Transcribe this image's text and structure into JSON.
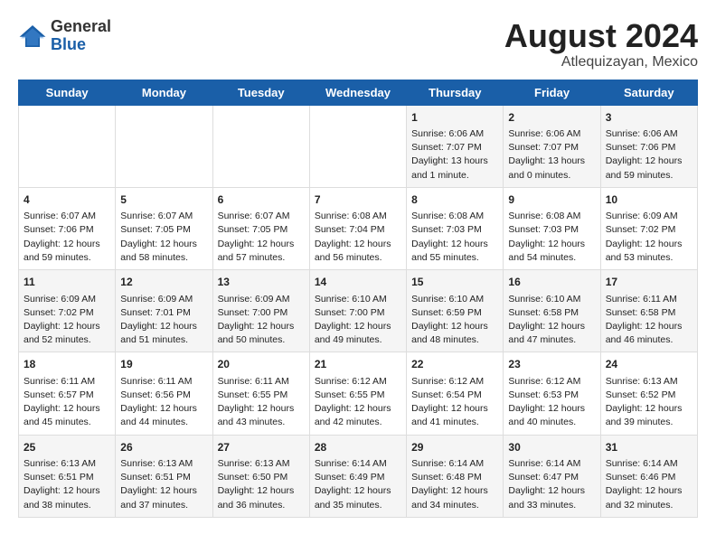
{
  "logo": {
    "general": "General",
    "blue": "Blue"
  },
  "title": {
    "month_year": "August 2024",
    "location": "Atlequizayan, Mexico"
  },
  "days_of_week": [
    "Sunday",
    "Monday",
    "Tuesday",
    "Wednesday",
    "Thursday",
    "Friday",
    "Saturday"
  ],
  "weeks": [
    [
      {
        "day": "",
        "content": ""
      },
      {
        "day": "",
        "content": ""
      },
      {
        "day": "",
        "content": ""
      },
      {
        "day": "",
        "content": ""
      },
      {
        "day": "1",
        "content": "Sunrise: 6:06 AM\nSunset: 7:07 PM\nDaylight: 13 hours\nand 1 minute."
      },
      {
        "day": "2",
        "content": "Sunrise: 6:06 AM\nSunset: 7:07 PM\nDaylight: 13 hours\nand 0 minutes."
      },
      {
        "day": "3",
        "content": "Sunrise: 6:06 AM\nSunset: 7:06 PM\nDaylight: 12 hours\nand 59 minutes."
      }
    ],
    [
      {
        "day": "4",
        "content": "Sunrise: 6:07 AM\nSunset: 7:06 PM\nDaylight: 12 hours\nand 59 minutes."
      },
      {
        "day": "5",
        "content": "Sunrise: 6:07 AM\nSunset: 7:05 PM\nDaylight: 12 hours\nand 58 minutes."
      },
      {
        "day": "6",
        "content": "Sunrise: 6:07 AM\nSunset: 7:05 PM\nDaylight: 12 hours\nand 57 minutes."
      },
      {
        "day": "7",
        "content": "Sunrise: 6:08 AM\nSunset: 7:04 PM\nDaylight: 12 hours\nand 56 minutes."
      },
      {
        "day": "8",
        "content": "Sunrise: 6:08 AM\nSunset: 7:03 PM\nDaylight: 12 hours\nand 55 minutes."
      },
      {
        "day": "9",
        "content": "Sunrise: 6:08 AM\nSunset: 7:03 PM\nDaylight: 12 hours\nand 54 minutes."
      },
      {
        "day": "10",
        "content": "Sunrise: 6:09 AM\nSunset: 7:02 PM\nDaylight: 12 hours\nand 53 minutes."
      }
    ],
    [
      {
        "day": "11",
        "content": "Sunrise: 6:09 AM\nSunset: 7:02 PM\nDaylight: 12 hours\nand 52 minutes."
      },
      {
        "day": "12",
        "content": "Sunrise: 6:09 AM\nSunset: 7:01 PM\nDaylight: 12 hours\nand 51 minutes."
      },
      {
        "day": "13",
        "content": "Sunrise: 6:09 AM\nSunset: 7:00 PM\nDaylight: 12 hours\nand 50 minutes."
      },
      {
        "day": "14",
        "content": "Sunrise: 6:10 AM\nSunset: 7:00 PM\nDaylight: 12 hours\nand 49 minutes."
      },
      {
        "day": "15",
        "content": "Sunrise: 6:10 AM\nSunset: 6:59 PM\nDaylight: 12 hours\nand 48 minutes."
      },
      {
        "day": "16",
        "content": "Sunrise: 6:10 AM\nSunset: 6:58 PM\nDaylight: 12 hours\nand 47 minutes."
      },
      {
        "day": "17",
        "content": "Sunrise: 6:11 AM\nSunset: 6:58 PM\nDaylight: 12 hours\nand 46 minutes."
      }
    ],
    [
      {
        "day": "18",
        "content": "Sunrise: 6:11 AM\nSunset: 6:57 PM\nDaylight: 12 hours\nand 45 minutes."
      },
      {
        "day": "19",
        "content": "Sunrise: 6:11 AM\nSunset: 6:56 PM\nDaylight: 12 hours\nand 44 minutes."
      },
      {
        "day": "20",
        "content": "Sunrise: 6:11 AM\nSunset: 6:55 PM\nDaylight: 12 hours\nand 43 minutes."
      },
      {
        "day": "21",
        "content": "Sunrise: 6:12 AM\nSunset: 6:55 PM\nDaylight: 12 hours\nand 42 minutes."
      },
      {
        "day": "22",
        "content": "Sunrise: 6:12 AM\nSunset: 6:54 PM\nDaylight: 12 hours\nand 41 minutes."
      },
      {
        "day": "23",
        "content": "Sunrise: 6:12 AM\nSunset: 6:53 PM\nDaylight: 12 hours\nand 40 minutes."
      },
      {
        "day": "24",
        "content": "Sunrise: 6:13 AM\nSunset: 6:52 PM\nDaylight: 12 hours\nand 39 minutes."
      }
    ],
    [
      {
        "day": "25",
        "content": "Sunrise: 6:13 AM\nSunset: 6:51 PM\nDaylight: 12 hours\nand 38 minutes."
      },
      {
        "day": "26",
        "content": "Sunrise: 6:13 AM\nSunset: 6:51 PM\nDaylight: 12 hours\nand 37 minutes."
      },
      {
        "day": "27",
        "content": "Sunrise: 6:13 AM\nSunset: 6:50 PM\nDaylight: 12 hours\nand 36 minutes."
      },
      {
        "day": "28",
        "content": "Sunrise: 6:14 AM\nSunset: 6:49 PM\nDaylight: 12 hours\nand 35 minutes."
      },
      {
        "day": "29",
        "content": "Sunrise: 6:14 AM\nSunset: 6:48 PM\nDaylight: 12 hours\nand 34 minutes."
      },
      {
        "day": "30",
        "content": "Sunrise: 6:14 AM\nSunset: 6:47 PM\nDaylight: 12 hours\nand 33 minutes."
      },
      {
        "day": "31",
        "content": "Sunrise: 6:14 AM\nSunset: 6:46 PM\nDaylight: 12 hours\nand 32 minutes."
      }
    ]
  ]
}
